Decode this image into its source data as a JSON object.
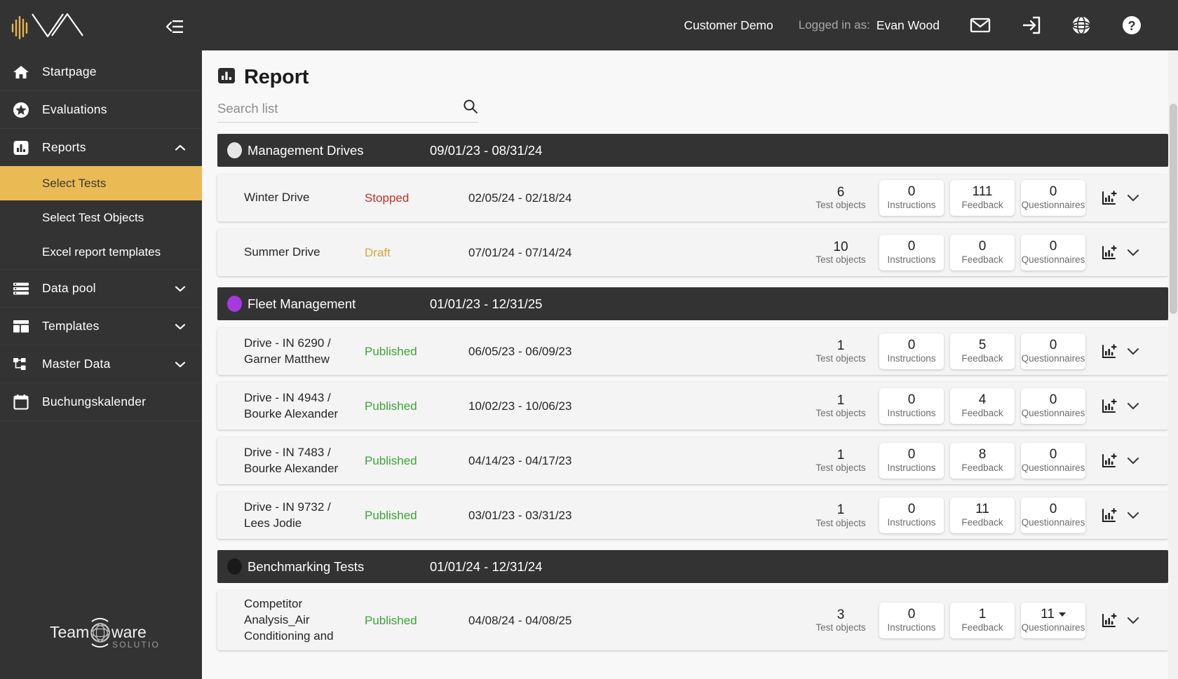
{
  "app": {
    "brand_name": "wave-logo",
    "collapse_icon": "collapse-sidebar-icon",
    "footer_logo_primary": "Team",
    "footer_logo_secondary": "ware",
    "footer_logo_tagline": "SOLUTIONS"
  },
  "colors": {
    "sidebar_bg": "#333333",
    "active_accent": "#eaba54",
    "status_published": "#3ca536",
    "status_stopped": "#bf3326",
    "status_draft": "#d7a63c",
    "group_dot_management": "#e6e6e6",
    "group_dot_fleet": "#a63ae0",
    "group_dot_benchmarking": "#1a1a1a"
  },
  "sidebar": {
    "items": [
      {
        "label": "Startpage",
        "icon": "home-icon",
        "expandable": false,
        "expanded": false
      },
      {
        "label": "Evaluations",
        "icon": "star-circle-icon",
        "expandable": false,
        "expanded": false
      },
      {
        "label": "Reports",
        "icon": "bar-chart-icon",
        "expandable": true,
        "expanded": true
      },
      {
        "label": "Data pool",
        "icon": "database-list-icon",
        "expandable": true,
        "expanded": false
      },
      {
        "label": "Templates",
        "icon": "layout-template-icon",
        "expandable": true,
        "expanded": false
      },
      {
        "label": "Master Data",
        "icon": "hierarchy-icon",
        "expandable": true,
        "expanded": false
      },
      {
        "label": "Buchungskalender",
        "icon": "calendar-icon",
        "expandable": false,
        "expanded": false
      }
    ],
    "reports_subitems": [
      {
        "label": "Select Tests",
        "active": true
      },
      {
        "label": "Select Test Objects",
        "active": false
      },
      {
        "label": "Excel report templates",
        "active": false
      }
    ]
  },
  "topbar": {
    "customer": "Customer Demo",
    "logged_in_label": "Logged in as:",
    "user_name": "Evan Wood",
    "icons": [
      "mail-icon",
      "logout-icon",
      "globe-icon",
      "help-circle-icon"
    ]
  },
  "page": {
    "title": "Report",
    "title_icon": "report-chart-icon"
  },
  "search": {
    "placeholder": "Search list",
    "value": "",
    "icon": "search-icon"
  },
  "groups": [
    {
      "name": "Management Drives",
      "dates": "09/01/23 - 08/31/24",
      "dot_color": "#e6e6e6",
      "rows": [
        {
          "name": "Winter Drive",
          "status": "Stopped",
          "status_class": "red",
          "dates": "02/05/24 - 02/18/24",
          "test_objects": {
            "value": "6",
            "label": "Test objects"
          },
          "instructions": {
            "value": "0",
            "label": "Instructions"
          },
          "feedback": {
            "value": "111",
            "label": "Feedback"
          },
          "questionnaires": {
            "value": "0",
            "label": "Questionnaires",
            "has_dropdown": false
          }
        },
        {
          "name": "Summer Drive",
          "status": "Draft",
          "status_class": "amber",
          "dates": "07/01/24 - 07/14/24",
          "test_objects": {
            "value": "10",
            "label": "Test objects"
          },
          "instructions": {
            "value": "0",
            "label": "Instructions"
          },
          "feedback": {
            "value": "0",
            "label": "Feedback"
          },
          "questionnaires": {
            "value": "0",
            "label": "Questionnaires",
            "has_dropdown": false
          }
        }
      ]
    },
    {
      "name": "Fleet Management",
      "dates": "01/01/23 - 12/31/25",
      "dot_color": "#a63ae0",
      "rows": [
        {
          "name": "Drive - IN 6290 / Garner Matthew",
          "status": "Published",
          "status_class": "green",
          "dates": "06/05/23 - 06/09/23",
          "test_objects": {
            "value": "1",
            "label": "Test objects"
          },
          "instructions": {
            "value": "0",
            "label": "Instructions"
          },
          "feedback": {
            "value": "5",
            "label": "Feedback"
          },
          "questionnaires": {
            "value": "0",
            "label": "Questionnaires",
            "has_dropdown": false
          }
        },
        {
          "name": "Drive - IN 4943 / Bourke Alexander",
          "status": "Published",
          "status_class": "green",
          "dates": "10/02/23 - 10/06/23",
          "test_objects": {
            "value": "1",
            "label": "Test objects"
          },
          "instructions": {
            "value": "0",
            "label": "Instructions"
          },
          "feedback": {
            "value": "4",
            "label": "Feedback"
          },
          "questionnaires": {
            "value": "0",
            "label": "Questionnaires",
            "has_dropdown": false
          }
        },
        {
          "name": "Drive - IN 7483 / Bourke Alexander",
          "status": "Published",
          "status_class": "green",
          "dates": "04/14/23 - 04/17/23",
          "test_objects": {
            "value": "1",
            "label": "Test objects"
          },
          "instructions": {
            "value": "0",
            "label": "Instructions"
          },
          "feedback": {
            "value": "8",
            "label": "Feedback"
          },
          "questionnaires": {
            "value": "0",
            "label": "Questionnaires",
            "has_dropdown": false
          }
        },
        {
          "name": "Drive - IN 9732 / Lees Jodie",
          "status": "Published",
          "status_class": "green",
          "dates": "03/01/23 - 03/31/23",
          "test_objects": {
            "value": "1",
            "label": "Test objects"
          },
          "instructions": {
            "value": "0",
            "label": "Instructions"
          },
          "feedback": {
            "value": "11",
            "label": "Feedback"
          },
          "questionnaires": {
            "value": "0",
            "label": "Questionnaires",
            "has_dropdown": false
          }
        }
      ]
    },
    {
      "name": "Benchmarking Tests",
      "dates": "01/01/24 - 12/31/24",
      "dot_color": "#1a1a1a",
      "rows": [
        {
          "name": "Competitor Analysis_Air Conditioning and",
          "status": "Published",
          "status_class": "green",
          "dates": "04/08/24 - 04/08/25",
          "test_objects": {
            "value": "3",
            "label": "Test objects"
          },
          "instructions": {
            "value": "0",
            "label": "Instructions"
          },
          "feedback": {
            "value": "1",
            "label": "Feedback"
          },
          "questionnaires": {
            "value": "11",
            "label": "Questionnaires",
            "has_dropdown": true
          }
        }
      ]
    }
  ],
  "row_actions": {
    "add_report_icon": "chart-add-icon",
    "expand_icon": "chevron-down-icon"
  }
}
